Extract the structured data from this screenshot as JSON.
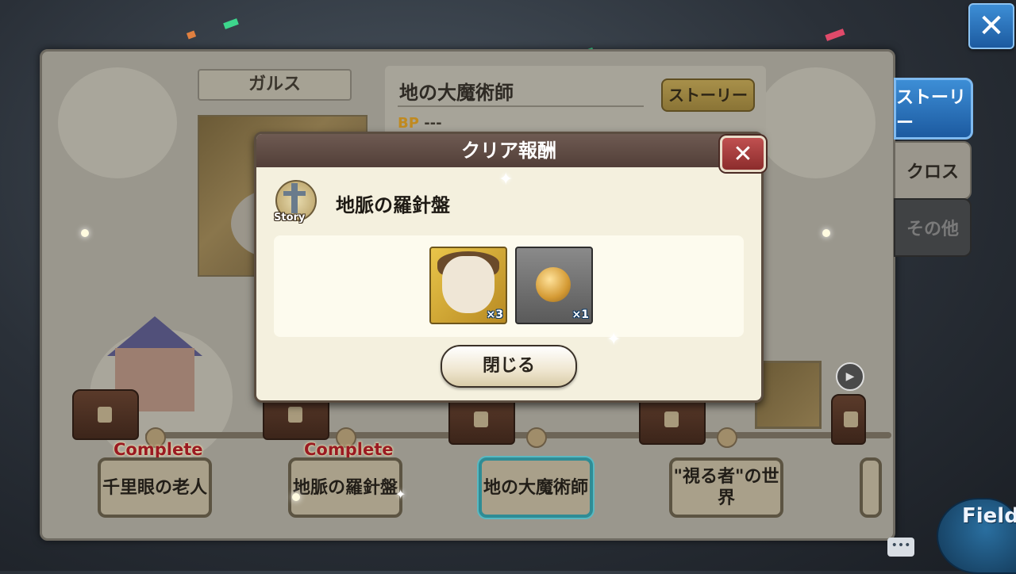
{
  "main": {
    "character_name": "ガルス",
    "stage_title": "地の大魔術師",
    "bp_label": "BP",
    "bp_value": "---",
    "story_button": "ストーリー"
  },
  "side_tabs": [
    {
      "label": "ストーリー",
      "active": true
    },
    {
      "label": "クロス",
      "active": false
    },
    {
      "label": "その他",
      "active": false
    }
  ],
  "stages": [
    {
      "label": "千里眼の老人",
      "status": "Complete"
    },
    {
      "label": "地脈の羅針盤",
      "status": "Complete"
    },
    {
      "label": "地の大魔術師",
      "status": "current"
    },
    {
      "label": "\"視る者\"の世界",
      "status": ""
    }
  ],
  "modal": {
    "title": "クリア報酬",
    "close_icon": "close-icon",
    "emblem_label": "Story",
    "reward_name": "地脈の羅針盤",
    "items": [
      {
        "icon": "character-portrait-icon",
        "quantity": "×3"
      },
      {
        "icon": "gold-coin-icon",
        "quantity": "×1"
      }
    ],
    "close_button": "閉じる"
  },
  "bottom": {
    "field_label": "Field",
    "chat_icon": "chat-bubble-icon"
  },
  "colors": {
    "accent_blue": "#1c5aa0",
    "modal_header": "#523f38",
    "complete_red": "#9a1a22",
    "current_stage_border": "#2f8c95"
  }
}
